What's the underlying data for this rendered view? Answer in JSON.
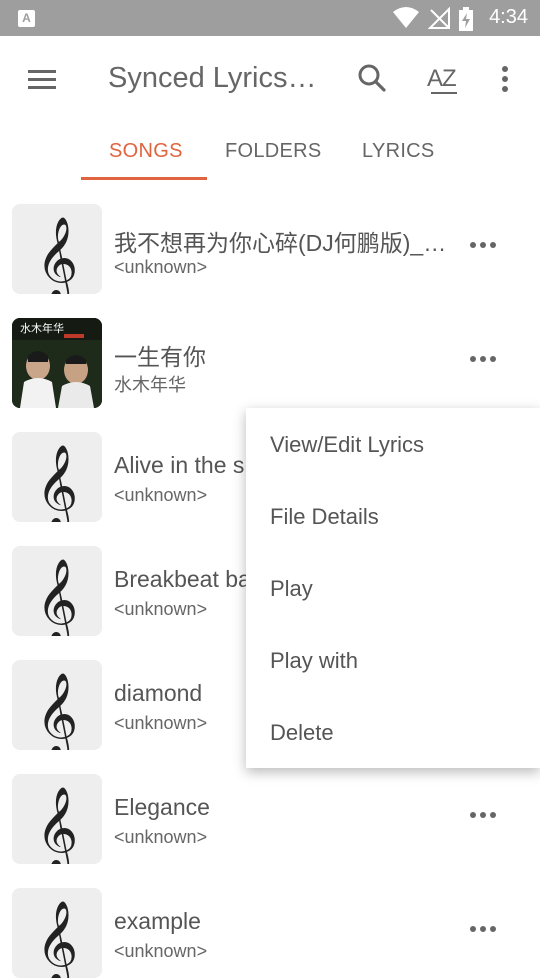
{
  "status_bar": {
    "time": "4:34",
    "notification_icon": "A",
    "icons": [
      "wifi-icon",
      "no-signal-icon",
      "battery-charging-icon"
    ]
  },
  "toolbar": {
    "title": "Synced Lyrics…",
    "icons": [
      "menu-icon",
      "search-icon",
      "sort-az-icon",
      "more-vert-icon"
    ],
    "sort_label": "AZ"
  },
  "tabs": [
    {
      "label": "SONGS",
      "active": true
    },
    {
      "label": "FOLDERS",
      "active": false
    },
    {
      "label": "LYRICS",
      "active": false
    }
  ],
  "songs": [
    {
      "title": "我不想再为你心碎(DJ何鹏版)_…",
      "artist": "<unknown>",
      "art": "treble-clef-icon"
    },
    {
      "title": "一生有你",
      "artist": "水木年华",
      "art": "album-cover",
      "cover_text": "水木年华"
    },
    {
      "title": "Alive in the s",
      "artist": "<unknown>",
      "art": "treble-clef-icon"
    },
    {
      "title": "Breakbeat ba",
      "artist": "<unknown>",
      "art": "treble-clef-icon"
    },
    {
      "title": "diamond",
      "artist": "<unknown>",
      "art": "treble-clef-icon"
    },
    {
      "title": "Elegance",
      "artist": "<unknown>",
      "art": "treble-clef-icon"
    },
    {
      "title": "example",
      "artist": "<unknown>",
      "art": "treble-clef-icon"
    }
  ],
  "context_menu": {
    "items": [
      "View/Edit Lyrics",
      "File Details",
      "Play",
      "Play with",
      "Delete"
    ]
  },
  "colors": {
    "accent": "#e0643f",
    "status_bar": "#9e9e9e",
    "thumb_bg": "#eeeeee"
  }
}
